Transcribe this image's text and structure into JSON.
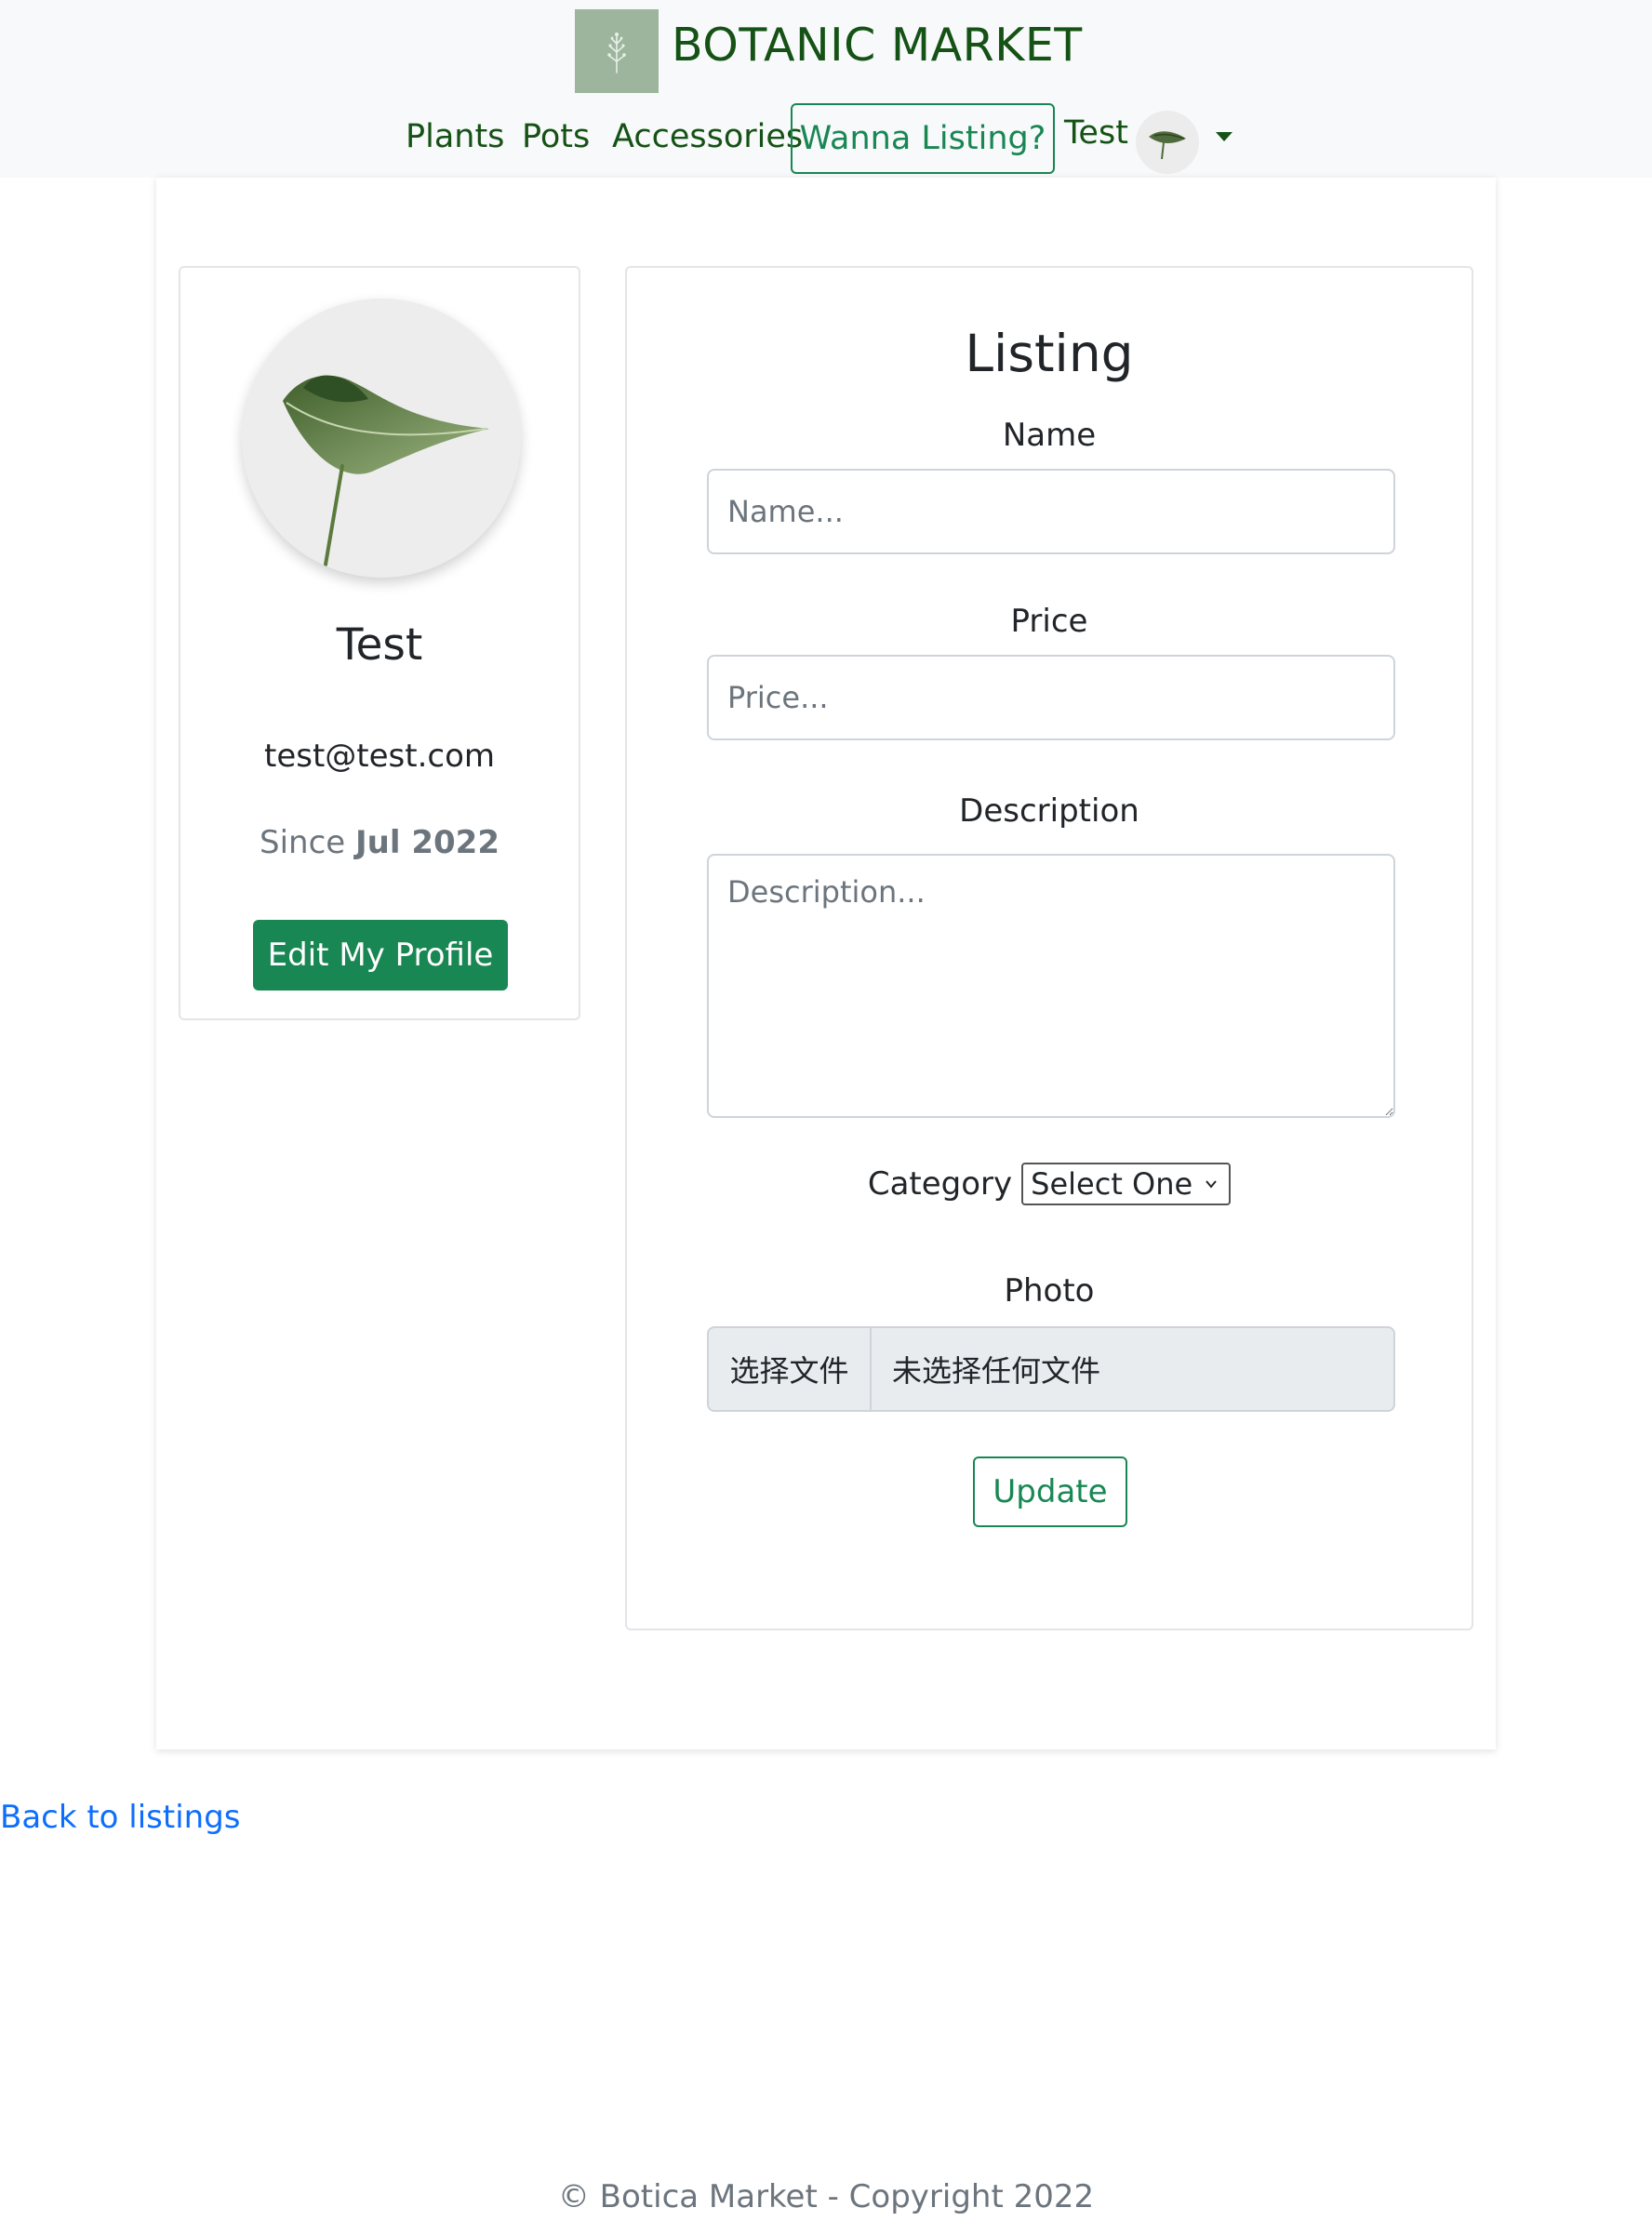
{
  "header": {
    "brand": "BOTANIC MARKET",
    "nav": {
      "plants": "Plants",
      "pots": "Pots",
      "accessories": "Accessories",
      "listing_cta": "Wanna Listing?",
      "user": "Test"
    }
  },
  "profile": {
    "name": "Test",
    "email": "test@test.com",
    "since_prefix": "Since",
    "since_date": "Jul 2022",
    "edit_button": "Edit My Profile"
  },
  "form": {
    "title": "Listing",
    "name_label": "Name",
    "name_placeholder": "Name...",
    "price_label": "Price",
    "price_placeholder": "Price...",
    "description_label": "Description",
    "description_placeholder": "Description...",
    "category_label": "Category",
    "category_selected": "Select One",
    "photo_label": "Photo",
    "file_button": "选择文件",
    "file_status": "未选择任何文件",
    "submit": "Update"
  },
  "back_link": "Back to listings",
  "footer": "© Botica Market - Copyright 2022",
  "colors": {
    "brand_green": "#155215",
    "button_green": "#198754",
    "link_blue": "#0d6efd",
    "header_bg": "#f8f9fa",
    "logo_bg": "#9db59d"
  }
}
